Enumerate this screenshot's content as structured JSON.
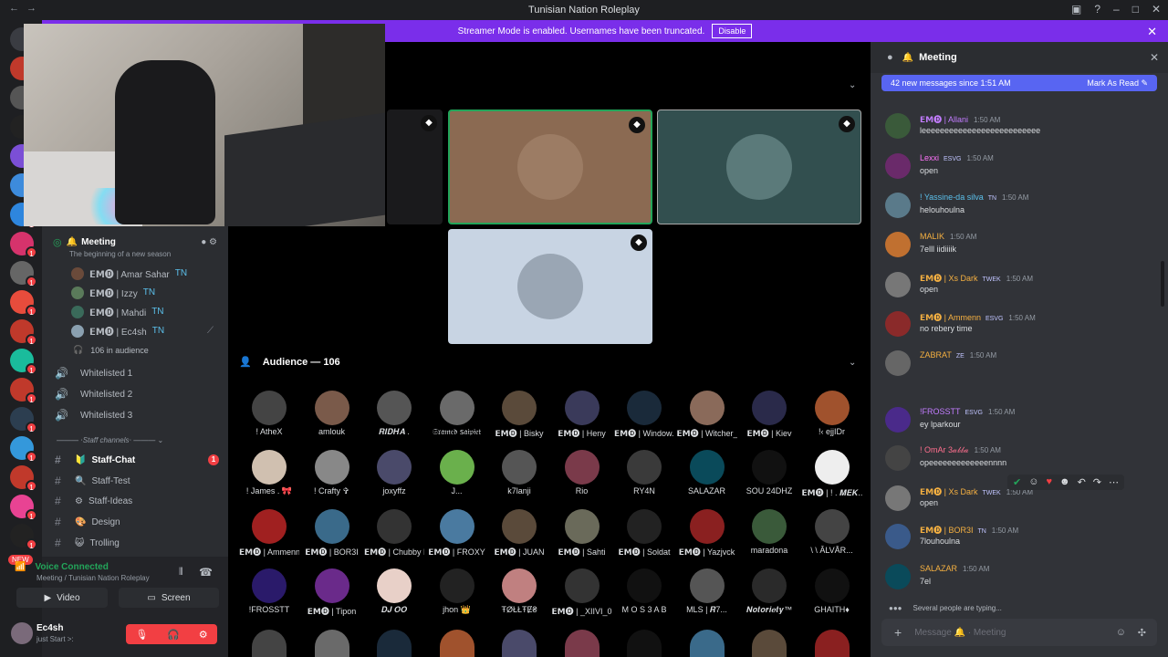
{
  "window": {
    "title": "Tunisian Nation Roleplay"
  },
  "banner": {
    "text": "Streamer Mode is enabled. Usernames have been truncated.",
    "button": "Disable"
  },
  "guild_badges": [
    "1",
    "1",
    "1",
    "1",
    "1",
    "1",
    "1",
    "1",
    "1",
    "1",
    "1",
    "1",
    "1"
  ],
  "guild_new": "NEW",
  "voice_channel": {
    "name": "Meeting",
    "topic": "The beginning of a new season",
    "members": [
      {
        "name": "𝗘𝗠🅓 | Amar Sahar",
        "tag": "TN"
      },
      {
        "name": "𝗘𝗠🅓 | Izzy",
        "tag": "TN"
      },
      {
        "name": "𝗘𝗠🅓 | Mahdi",
        "tag": "TN"
      },
      {
        "name": "𝗘𝗠🅓 | Ec4sh",
        "tag": "TN"
      }
    ],
    "audience": "106 in audience"
  },
  "channels": [
    {
      "name": "Whitelisted 1"
    },
    {
      "name": "Whitelisted 2"
    },
    {
      "name": "Whitelisted 3"
    }
  ],
  "category": "Staff channels",
  "text_channels": [
    {
      "name": "Staff-Chat",
      "emoji": "🔰",
      "badge": "1"
    },
    {
      "name": "Staff-Test",
      "emoji": "🔍",
      "badge": ""
    },
    {
      "name": "Staff-Ideas",
      "emoji": "⚙",
      "badge": ""
    },
    {
      "name": "Design",
      "emoji": "🎨",
      "badge": ""
    },
    {
      "name": "Trolling",
      "emoji": "😺",
      "badge": ""
    }
  ],
  "voice_status": {
    "title": "Voice Connected",
    "sub": "Meeting / Tunisian Nation Roleplay",
    "video": "Video",
    "screen": "Screen"
  },
  "user": {
    "name": "Ec4sh",
    "status": "just Start >:"
  },
  "audience": {
    "label": "Audience — 106",
    "members": [
      "! AtheX",
      "amlouk",
      "𝑹𝑰𝑫𝑯𝑨 .",
      "𝔖𝔯𝔞𝔪𝔢𝔡 ꜱ𝔞𝔦𝔭𝔦𝔢𝔱",
      "𝗘𝗠🅓 | Bisky",
      "𝗘𝗠🅓 | Heny",
      "𝗘𝗠🅓 | Window...",
      "𝗘𝗠🅓 | Witcher_X",
      "𝗘𝗠🅓 | Kiev",
      "!‹ ejjIDr",
      "! James . 🎀",
      "! Crafty ✞",
      "joxyffz",
      "J...",
      "k7lanji",
      "Rio",
      "RY4N",
      "SALAZAR",
      "SOU 24DHZ",
      "𝗘𝗠🅓 | ! . 𝑴𝑬𝑲...",
      "𝗘𝗠🅓 | Ammenn",
      "𝗘𝗠🅓 | BOR3I",
      "𝗘𝗠🅓 | Chubby D",
      "𝗘𝗠🅓 | FROXY",
      "𝗘𝗠🅓 | JUAN",
      "𝗘𝗠🅓 | Sahti",
      "𝗘𝗠🅓 | Soldat",
      "𝗘𝗠🅓 | Yazjvck",
      "maradona",
      "\\ \\ ÂLVÅR...",
      "!FROSSTT",
      "𝗘𝗠🅓 | Tipon",
      "𝑫𝑱 𝑶𝑶",
      "jhon 👑",
      "ŦØŁŁŦɆ₴",
      "𝗘𝗠🅓 | _XIIVI_07",
      "M O S 3 A B",
      "MLS | 𝑹7...",
      "𝑵𝒐𝒕𝒐𝒓𝒊𝒆𝒕𝒚™",
      "GHAITH♦"
    ]
  },
  "chat": {
    "title": "Meeting",
    "new_messages": "42 new messages since 1:51 AM",
    "mark_read": "Mark As Read",
    "messages": [
      {
        "author": "𝗘𝗠🅓 | Allani",
        "time": "1:50 AM",
        "text": "leeeeeeeeeeeeeeeeeeeeeeeeee",
        "color": "#c27cff"
      },
      {
        "author": "Lexxi",
        "tag": "ESVG",
        "time": "1:50 AM",
        "text": "open",
        "color": "#ff73fa"
      },
      {
        "author": "! Yassine-da silva",
        "tag": "TN",
        "time": "1:50 AM",
        "text": "helouhoulna",
        "color": "#5bc0eb"
      },
      {
        "author": "MALIK",
        "time": "1:50 AM",
        "text": "7elll iidiiiik",
        "color": "#f5b041"
      },
      {
        "author": "𝗘𝗠🅓 | Xs Dark",
        "tag": "TWEK",
        "time": "1:50 AM",
        "text": "open",
        "color": "#f5b041"
      },
      {
        "author": "𝗘𝗠🅓 | Ammenn",
        "tag": "ESVG",
        "time": "1:50 AM",
        "text": "no rebery time",
        "color": "#f5b041"
      },
      {
        "author": "ZABRAT",
        "tag": "ZE",
        "time": "1:50 AM",
        "text": "",
        "color": "#f5b041"
      },
      {
        "author": "!FROSSTT",
        "tag": "ESVG",
        "time": "1:50 AM",
        "text": "ey lparkour",
        "color": "#c27cff"
      },
      {
        "author": "! OmAr 3𝒶𝒷𝒷𝒶",
        "time": "1:50 AM",
        "text": "opeeeeeeeeeeeeennnn",
        "color": "#ff6f8e"
      },
      {
        "author": "𝗘𝗠🅓 | Xs Dark",
        "tag": "TWEK",
        "time": "1:50 AM",
        "text": "open",
        "color": "#f5b041"
      },
      {
        "author": "𝗘𝗠🅓 | BOR3I",
        "tag": "TN",
        "time": "1:50 AM",
        "text": "7louhoulna",
        "color": "#f5b041"
      },
      {
        "author": "SALAZAR",
        "time": "1:50 AM",
        "text": "7el",
        "color": "#f5b041"
      }
    ],
    "typing": "Several people are typing...",
    "input_placeholder": "Message 🔔 · Meeting"
  }
}
